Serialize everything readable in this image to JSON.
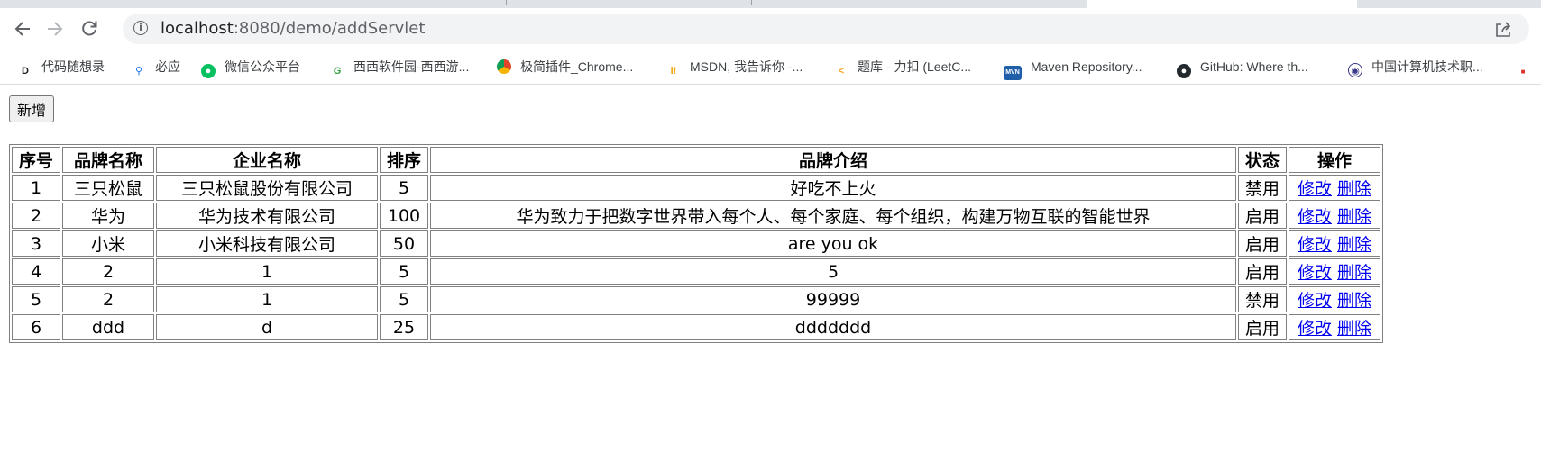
{
  "browser": {
    "url_host": "localhost",
    "url_path": ":8080/demo/addServlet",
    "bookmarks": [
      {
        "label": "代码随想录",
        "icon": "daimasuixiang-icon",
        "color": "#202124"
      },
      {
        "label": "必应",
        "icon": "bing-search-icon",
        "color": "#1a73e8"
      },
      {
        "label": "微信公众平台",
        "icon": "wechat-icon",
        "color": "#07c160"
      },
      {
        "label": "西西软件园-西西游...",
        "icon": "cr173-icon",
        "color": "#2e9e3c"
      },
      {
        "label": "极简插件_Chrome...",
        "icon": "chrome-plugin-icon",
        "color": "#e0452b"
      },
      {
        "label": "MSDN, 我告诉你 -...",
        "icon": "msdn-icon",
        "color": "#f4a100"
      },
      {
        "label": "题库 - 力扣 (LeetC...",
        "icon": "leetcode-icon",
        "color": "#f89f1b"
      },
      {
        "label": "Maven Repository...",
        "icon": "maven-icon",
        "color": "#1f5fa8"
      },
      {
        "label": "GitHub: Where th...",
        "icon": "github-icon",
        "color": "#24292e"
      },
      {
        "label": "中国计算机技术职...",
        "icon": "ruankao-icon",
        "color": "#3a3a8c"
      },
      {
        "label": "",
        "icon": "extra-bookmark-icon",
        "color": "#d9342b"
      }
    ]
  },
  "page": {
    "add_button": "新增",
    "table": {
      "headers": {
        "id": "序号",
        "brand": "品牌名称",
        "company": "企业名称",
        "order": "排序",
        "desc": "品牌介绍",
        "status": "状态",
        "ops": "操作"
      },
      "edit_label": "修改",
      "delete_label": "删除",
      "rows": [
        {
          "id": "1",
          "brand": "三只松鼠",
          "company": "三只松鼠股份有限公司",
          "order": "5",
          "desc": "好吃不上火",
          "status": "禁用"
        },
        {
          "id": "2",
          "brand": "华为",
          "company": "华为技术有限公司",
          "order": "100",
          "desc": "华为致力于把数字世界带入每个人、每个家庭、每个组织，构建万物互联的智能世界",
          "status": "启用"
        },
        {
          "id": "3",
          "brand": "小米",
          "company": "小米科技有限公司",
          "order": "50",
          "desc": "are you ok",
          "status": "启用"
        },
        {
          "id": "4",
          "brand": "2",
          "company": "1",
          "order": "5",
          "desc": "5",
          "status": "启用"
        },
        {
          "id": "5",
          "brand": "2",
          "company": "1",
          "order": "5",
          "desc": "99999",
          "status": "禁用"
        },
        {
          "id": "6",
          "brand": "ddd",
          "company": "d",
          "order": "25",
          "desc": "ddddddd",
          "status": "启用"
        }
      ]
    }
  }
}
